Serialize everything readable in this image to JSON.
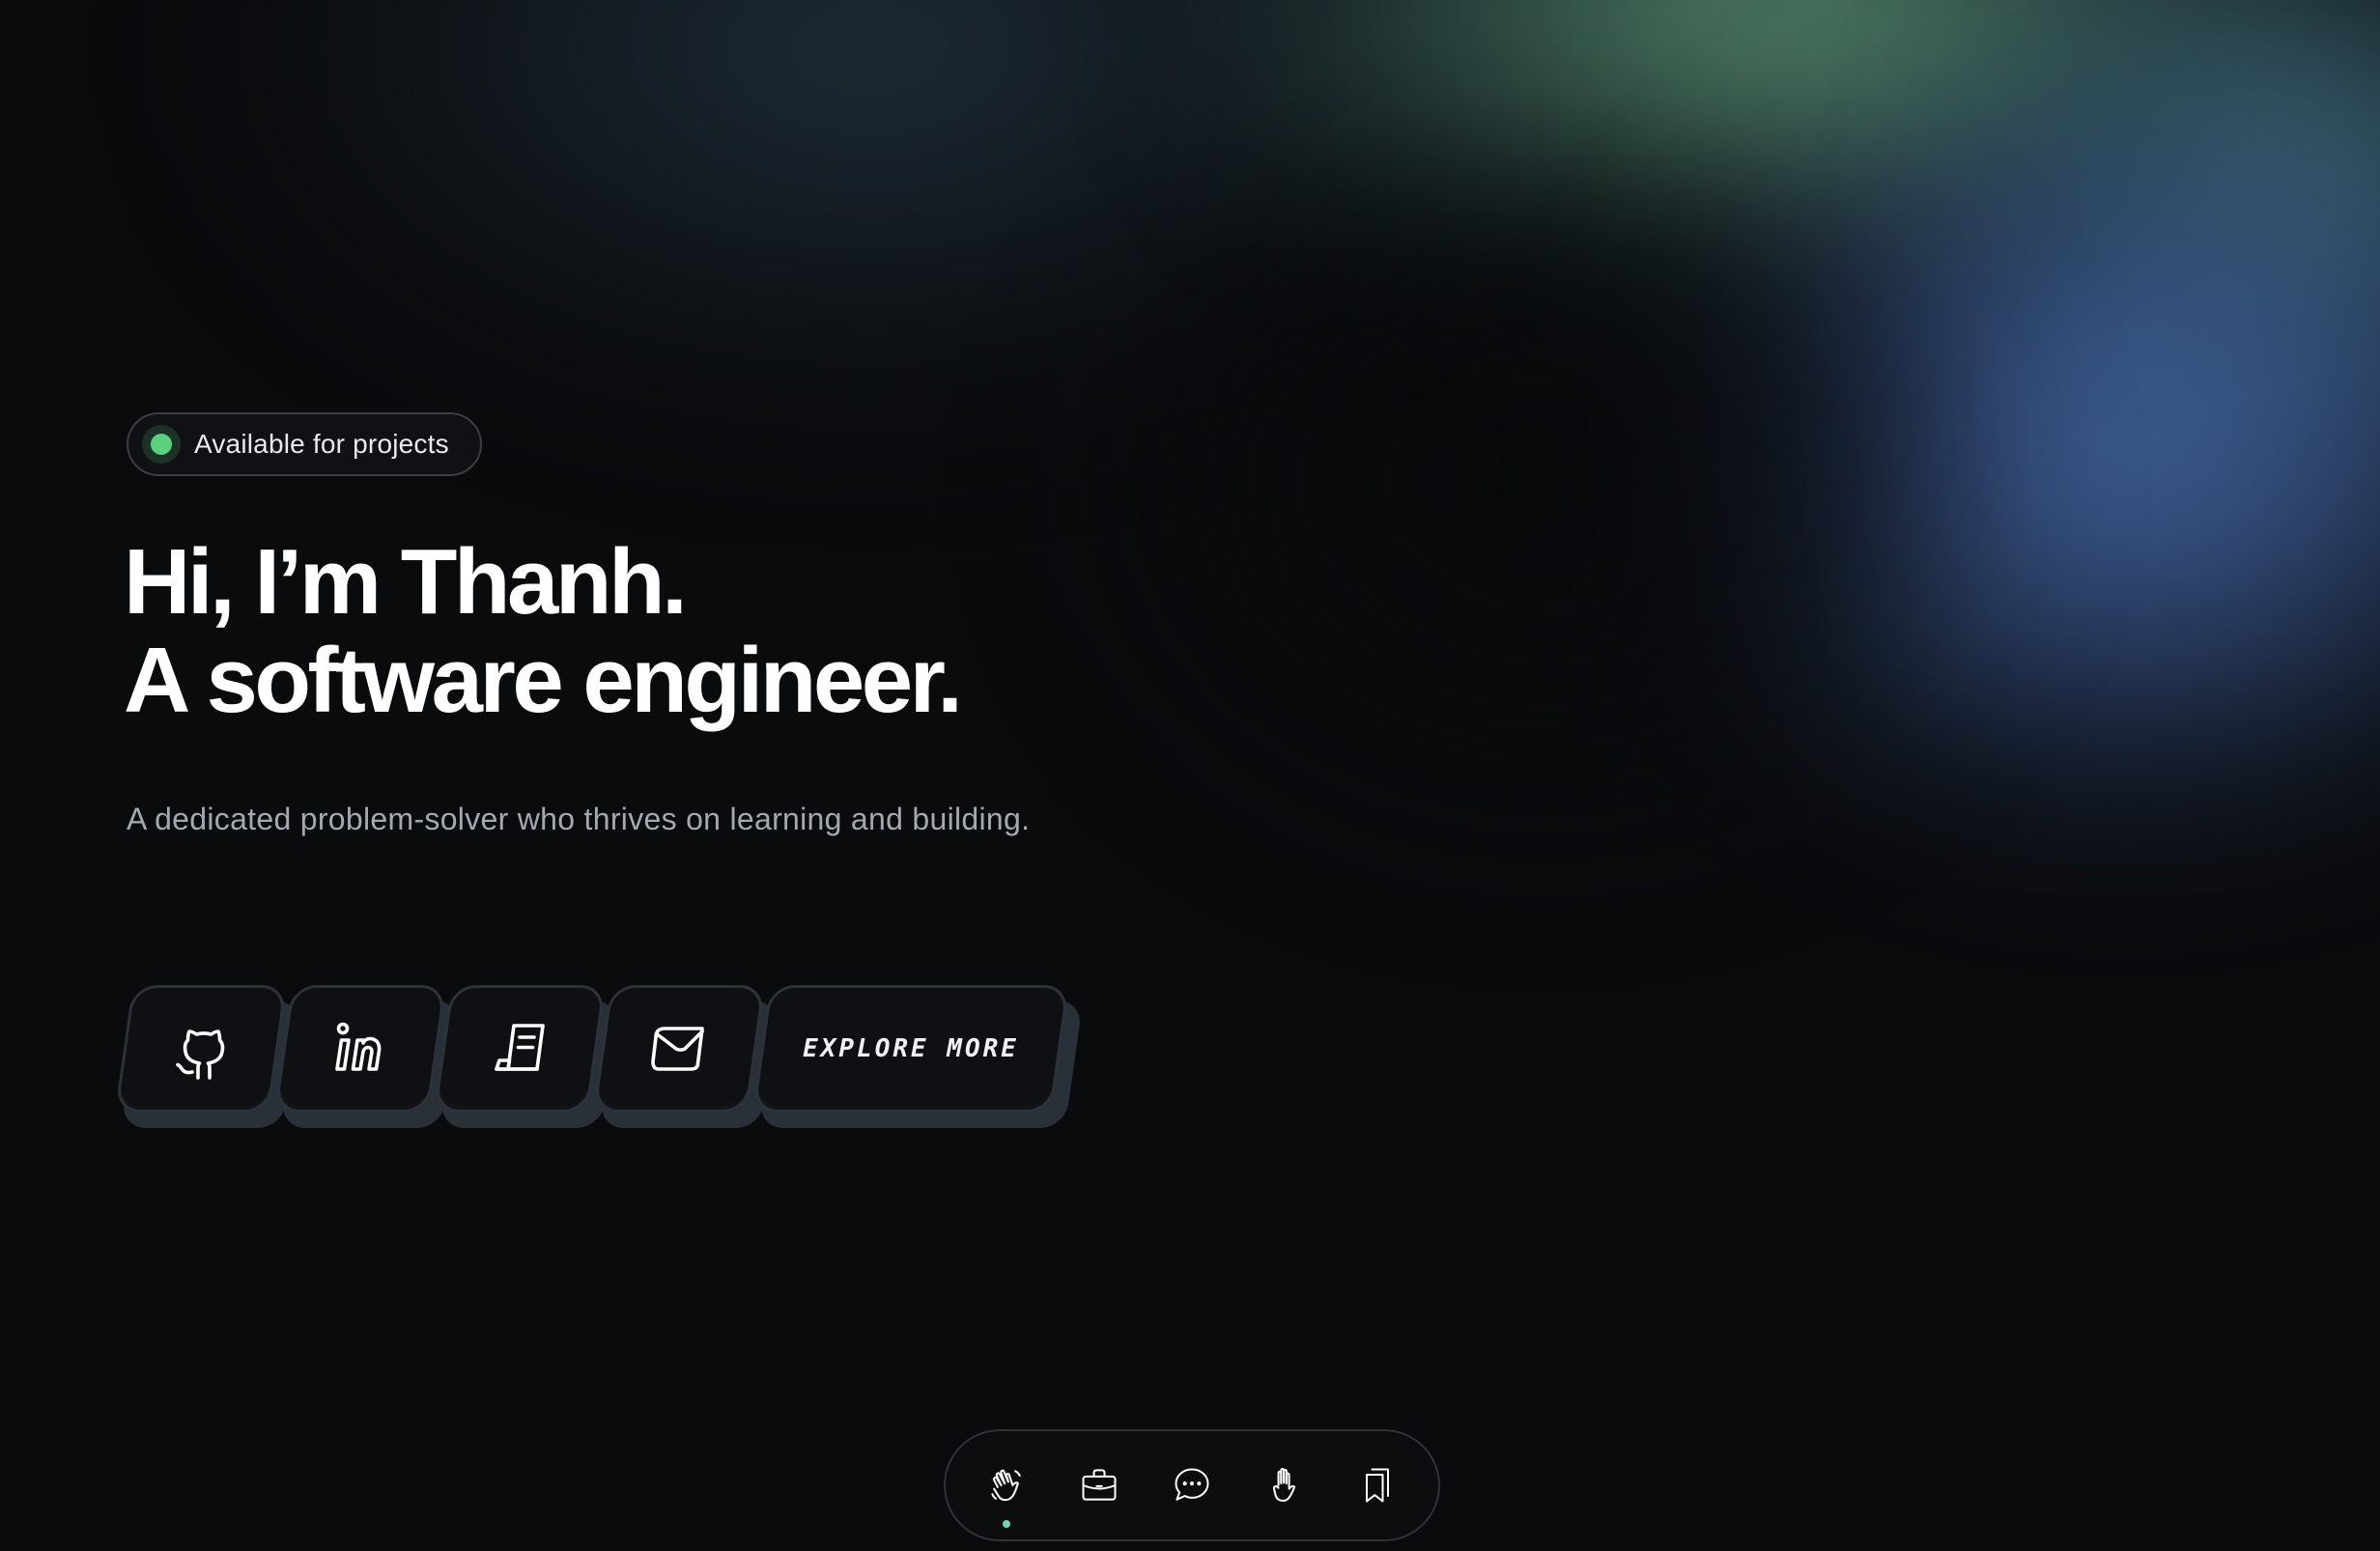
{
  "status_badge": {
    "label": "Available for projects",
    "dot_color": "#5bd17f"
  },
  "hero": {
    "line1": "Hi, I’m Thanh.",
    "line2": "A software engineer.",
    "subtitle": "A dedicated problem-solver who thrives on learning and building."
  },
  "actions": [
    {
      "icon": "github-icon"
    },
    {
      "icon": "linkedin-icon"
    },
    {
      "icon": "resume-scroll-icon"
    },
    {
      "icon": "mail-icon"
    },
    {
      "label": "EXPLORE MORE"
    }
  ],
  "dock": {
    "items": [
      {
        "icon": "wave-hand-icon",
        "active": true
      },
      {
        "icon": "briefcase-icon",
        "active": false
      },
      {
        "icon": "chat-bubble-icon",
        "active": false
      },
      {
        "icon": "raised-hand-icon",
        "active": false
      },
      {
        "icon": "bookmarks-icon",
        "active": false
      }
    ],
    "active_color": "#6fd6b0"
  },
  "colors": {
    "background": "#0a0b0d",
    "aurora_green": "#6eaa82",
    "aurora_blue": "#5078be"
  }
}
